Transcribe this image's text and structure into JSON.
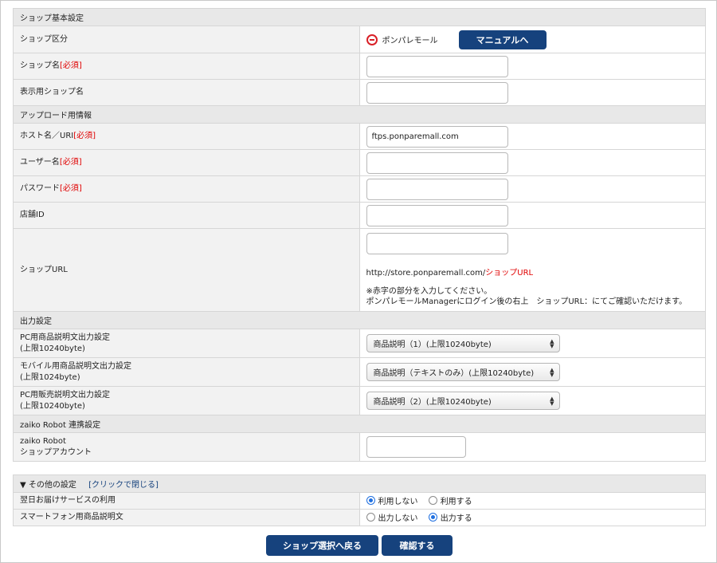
{
  "basic": {
    "section_title": "ショップ基本設定",
    "shop_type_label": "ショップ区分",
    "shop_type_value": "ポンパレモール",
    "manual_button": "マニュアルへ",
    "shop_name_label": "ショップ名",
    "shop_name_value": "",
    "display_name_label": "表示用ショップ名",
    "display_name_value": ""
  },
  "required_mark": "[必須]",
  "upload": {
    "section_title": "アップロード用情報",
    "host_label": "ホスト名／URI",
    "host_value": "ftps.ponparemall.com",
    "user_label": "ユーザー名",
    "user_value": "",
    "password_label": "パスワード",
    "password_value": "",
    "store_id_label": "店舗ID",
    "store_id_value": "",
    "shop_url_label": "ショップURL",
    "shop_url_value": "",
    "url_base": "http://store.ponparemall.com/",
    "url_suffix": "ショップURL",
    "note_line1": "※赤字の部分を入力してください。",
    "note_line2": "ポンパレモールManagerにログイン後の右上　ショップURL：にてご確認いただけます。"
  },
  "output": {
    "section_title": "出力設定",
    "rows": [
      {
        "label1": "PC用商品説明文出力設定",
        "label2": "(上限10240byte)",
        "selected": "商品説明（1）(上限10240byte)"
      },
      {
        "label1": "モバイル用商品説明文出力設定",
        "label2": "(上限1024byte)",
        "selected": "商品説明（テキストのみ）(上限10240byte)"
      },
      {
        "label1": "PC用販売説明文出力設定",
        "label2": "(上限10240byte)",
        "selected": "商品説明（2）(上限10240byte)"
      }
    ]
  },
  "zaiko": {
    "section_title": "zaiko Robot 連携設定",
    "label1": "zaiko Robot",
    "label2": "ショップアカウント",
    "value": ""
  },
  "other": {
    "toggle_arrow": "▼",
    "section_title": "その他の設定",
    "toggle_link": "[クリックで閉じる]",
    "next_day_label": "翌日お届けサービスの利用",
    "next_day_options": [
      "利用しない",
      "利用する"
    ],
    "next_day_selected": 0,
    "smartphone_label": "スマートフォン用商品説明文",
    "smartphone_options": [
      "出力しない",
      "出力する"
    ],
    "smartphone_selected": 1
  },
  "footer": {
    "back_button": "ショップ選択へ戻る",
    "confirm_button": "確認する"
  },
  "colors": {
    "button_bg": "#16427d",
    "required": "#e00000",
    "radio_active": "#1f6fe0"
  }
}
